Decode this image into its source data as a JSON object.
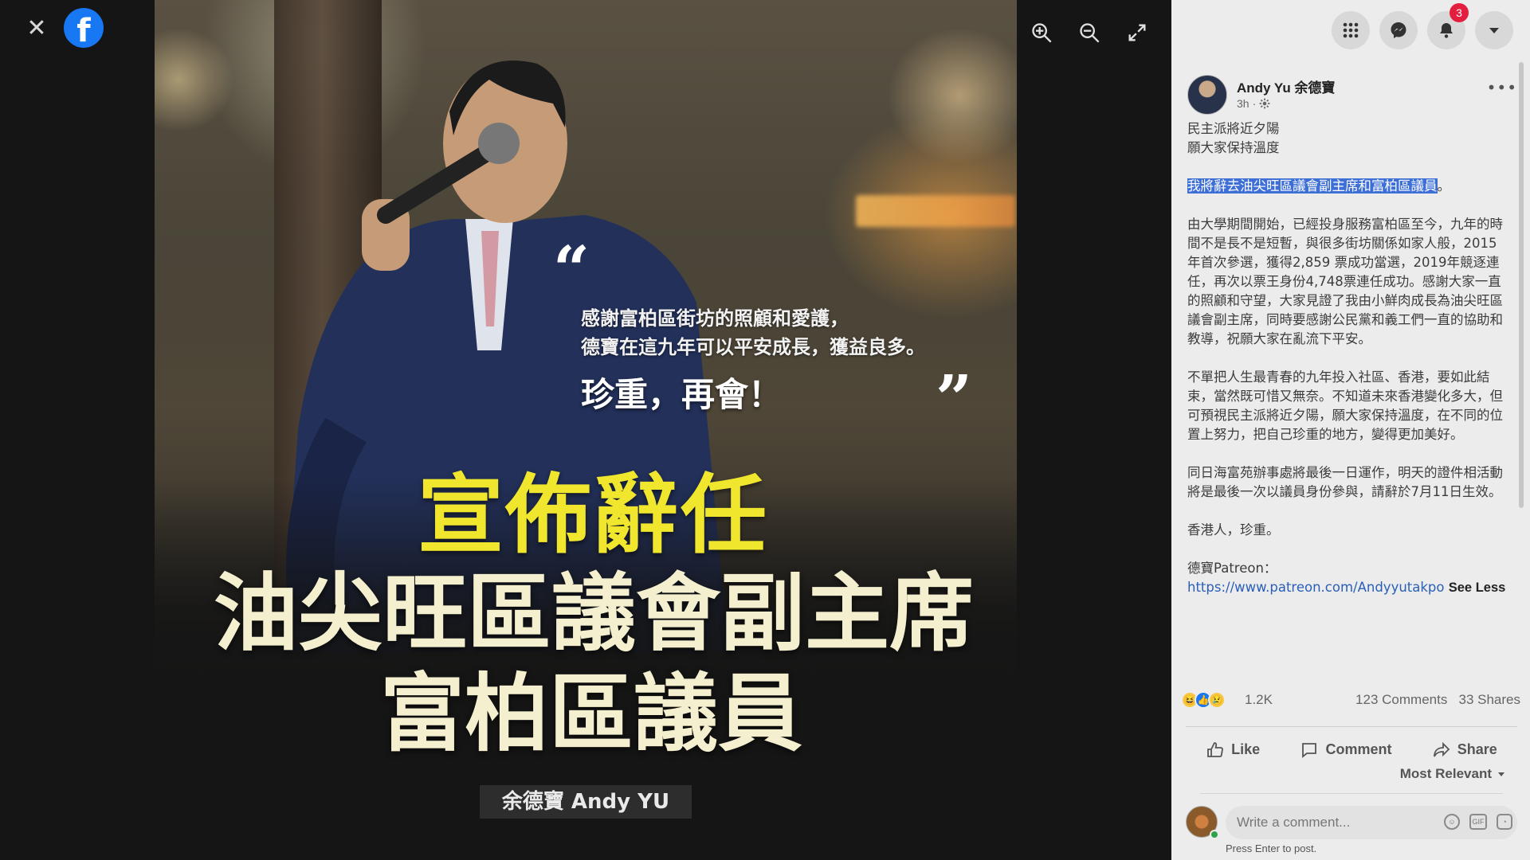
{
  "viewer": {
    "close_label": "✕",
    "logo_letter": "f",
    "image": {
      "quote_open": "“",
      "quote_close": "”",
      "thanks_line1": "感謝富柏區街坊的照顧和愛護，",
      "thanks_line2": "德寶在這九年可以平安成長，獲益良多。",
      "farewell": "珍重，再會！",
      "headline_yellow": "宣佈辭任",
      "headline_line1": "油尖旺區議會副主席",
      "headline_line2": "富柏區議員",
      "name_tag": "余德寶 Andy YU"
    }
  },
  "topbar": {
    "notification_count": "3"
  },
  "post": {
    "author": "Andy Yu 余德寶",
    "time": "3h",
    "paragraph1_line1": "民主派將近夕陽",
    "paragraph1_line2": "願大家保持溫度",
    "highlighted": "我將辭去油尖旺區議會副主席和富柏區議員",
    "highlighted_tail": "。",
    "paragraph2": "由大學期間開始，已經投身服務富柏區至今，九年的時間不是長不是短暫，與很多街坊關係如家人般，2015年首次參選，獲得2,859 票成功當選，2019年競逐連任，再次以票王身份4,748票連任成功。感謝大家一直的照顧和守望，大家見證了我由小鮮肉成長為油尖旺區議會副主席，同時要感謝公民黨和義工們一直的協助和教導，祝願大家在亂流下平安。",
    "paragraph3": "不單把人生最青春的九年投入社區、香港，要如此結束，當然既可惜又無奈。不知道未來香港變化多大，但可預視民主派將近夕陽，願大家保持溫度，在不同的位置上努力，把自己珍重的地方，變得更加美好。",
    "paragraph4": "同日海富苑辦事處將最後一日運作，明天的證件相活動將是最後一次以議員身份參與，請辭於7月11日生效。",
    "paragraph5": "香港人，珍重。",
    "patreon_label": "德寶Patreon：",
    "patreon_url": "https://www.patreon.com/Andyyutakpo",
    "see_less": "See Less"
  },
  "stats": {
    "reactions": "1.2K",
    "comments": "123 Comments",
    "shares": "33 Shares"
  },
  "actions": {
    "like": "Like",
    "comment": "Comment",
    "share": "Share"
  },
  "sort_label": "Most Relevant",
  "comment_box": {
    "placeholder": "Write a comment...",
    "gif_label": "GIF",
    "hint": "Press Enter to post."
  }
}
